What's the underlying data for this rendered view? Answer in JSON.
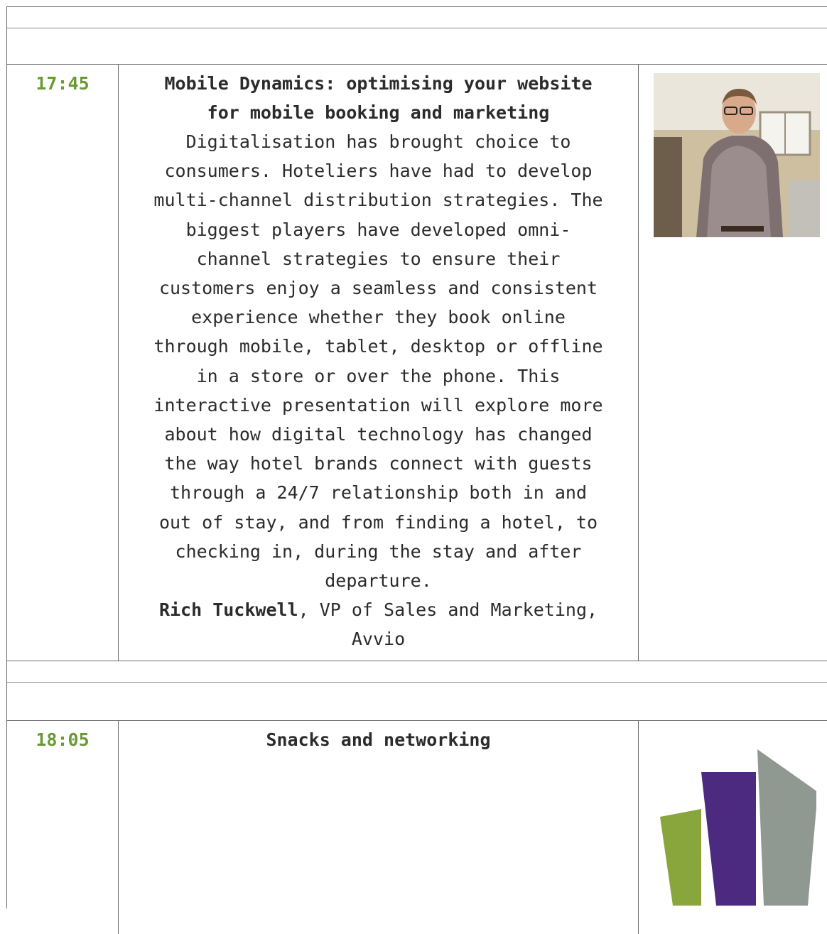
{
  "sessions": [
    {
      "time": "17:45",
      "title_line1": "Mobile Dynamics: optimising your website",
      "title_line2": "for mobile booking and marketing",
      "description_lines": [
        "Digitalisation has brought choice to",
        "consumers. Hoteliers have had to develop",
        "multi-channel distribution strategies. The",
        "biggest players have developed omni-",
        "channel strategies to ensure their",
        "customers enjoy a seamless and consistent",
        "experience whether they book online",
        "through mobile, tablet, desktop or offline",
        "in a store or over the phone. This",
        "interactive presentation will explore more",
        "about how digital technology has changed",
        "the way hotel brands connect with guests",
        "through a 24/7 relationship both in and",
        "out of stay, and from finding a hotel, to",
        "checking in, during the stay and after",
        "departure."
      ],
      "speaker_name": "Rich Tuckwell",
      "speaker_role_line1": ", VP of Sales and Marketing,",
      "speaker_role_line2": "Avvio",
      "image": "speaker-photo"
    },
    {
      "time": "18:05",
      "title_line1": "Snacks and networking",
      "image": "organiser-logo"
    }
  ],
  "colors": {
    "time_green": "#6a9a35",
    "logo_green": "#88a63b",
    "logo_purple": "#4b2a7f",
    "logo_grey": "#8f9891",
    "border": "#6b6b6b"
  }
}
